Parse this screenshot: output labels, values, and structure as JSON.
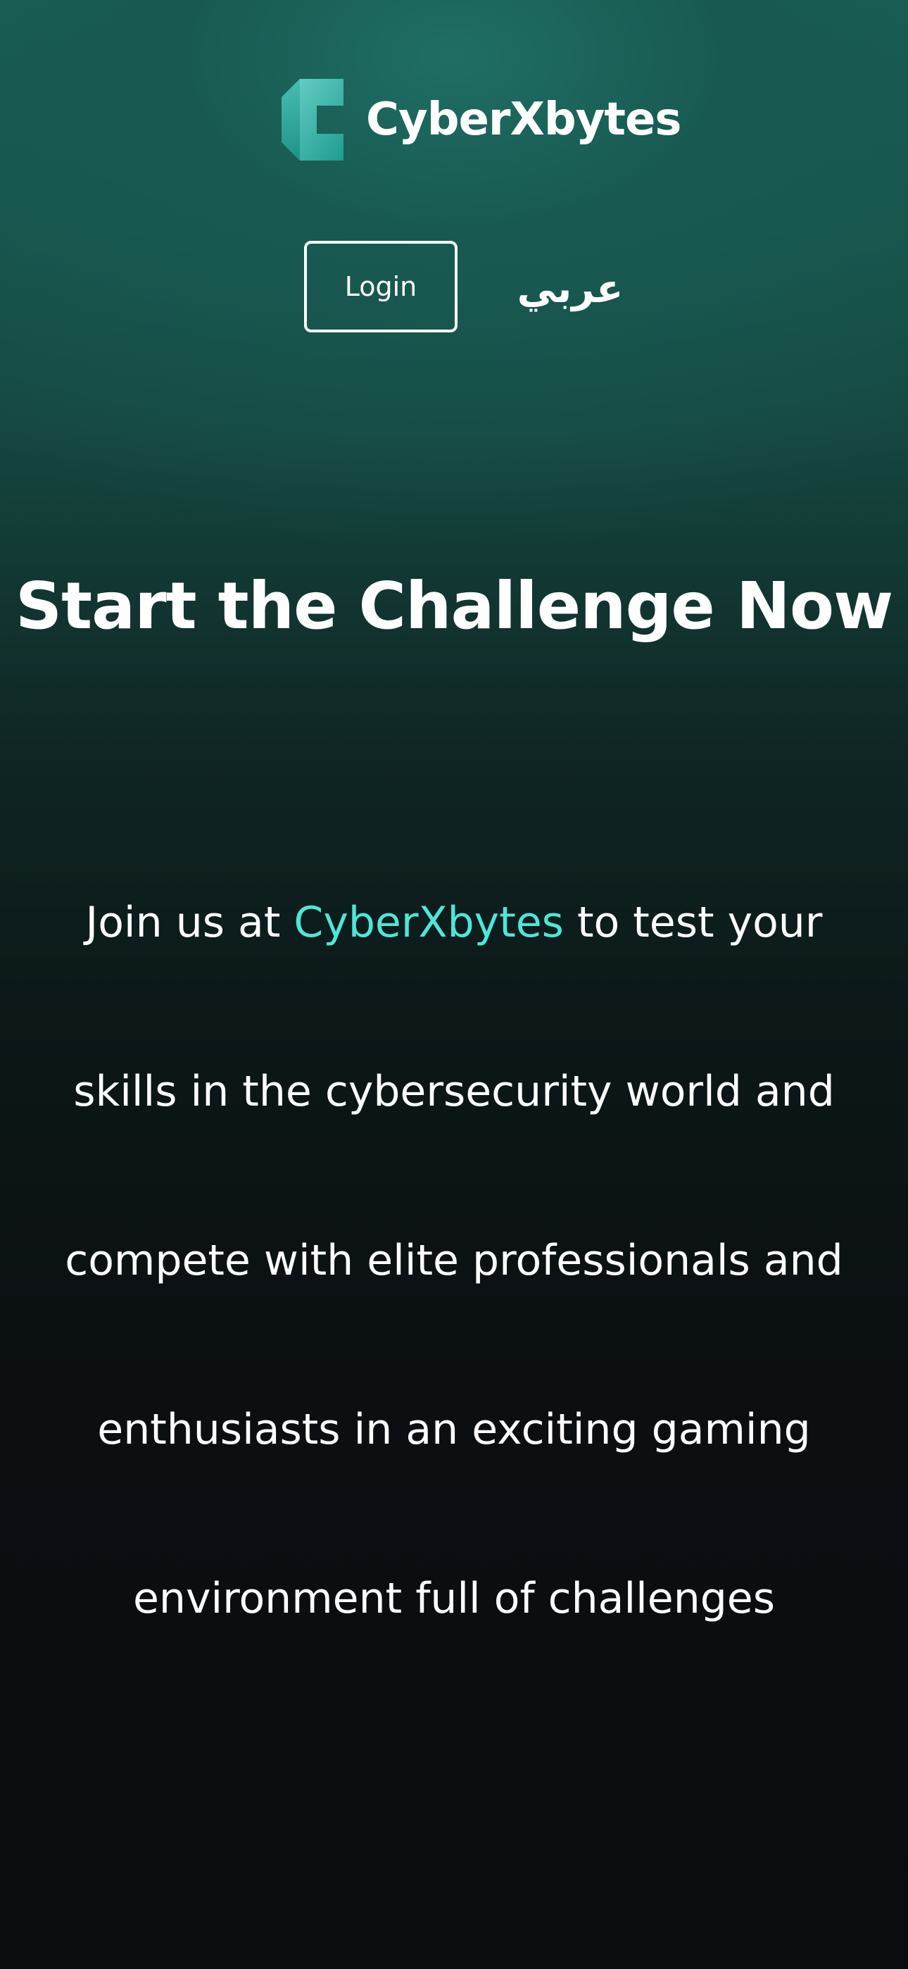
{
  "header": {
    "brand_name": "CyberXbytes",
    "logo_icon": "cyberxbytes-logo-icon",
    "login_label": "Login",
    "language_label": "عربي"
  },
  "hero": {
    "title": "Start the Challenge Now",
    "text_prefix": "Join us at ",
    "text_brand": "CyberXbytes",
    "text_suffix": " to test your skills in the cybersecurity world and compete with elite professionals and enthusiasts in an exciting gaming environment full of challenges"
  },
  "colors": {
    "accent": "#4ee6d6",
    "background_top": "#1f6e64",
    "background_bottom": "#0a0d10",
    "text": "#ffffff"
  }
}
